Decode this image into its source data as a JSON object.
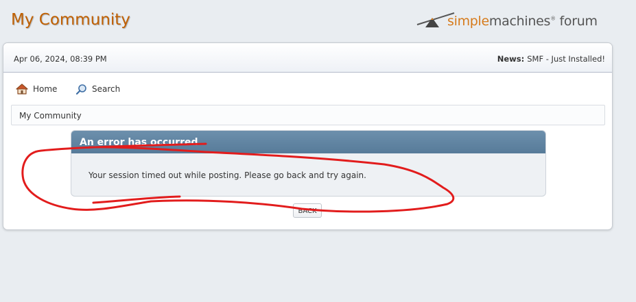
{
  "header": {
    "forum_name": "My Community",
    "logo": {
      "word_highlight": "simple",
      "word_rest": "machines",
      "registered": "®",
      "word_forum": "forum"
    }
  },
  "upper_bar": {
    "date": "Apr 06, 2024, 08:39 PM",
    "news_label": "News:",
    "news_text": "SMF - Just Installed!"
  },
  "menu": {
    "items": [
      {
        "label": "Home",
        "icon": "home-icon"
      },
      {
        "label": "Search",
        "icon": "search-icon"
      }
    ]
  },
  "breadcrumb": {
    "items": [
      "My Community"
    ]
  },
  "error": {
    "title": "An error has occurred",
    "message": "Your session timed out while posting. Please go back and try again."
  },
  "back_button": {
    "label": "BACK"
  },
  "colors": {
    "page_background": "#e9edf1",
    "forum_title": "#c06002",
    "logo_highlight": "#d67b1c",
    "error_header": "#5f83a1",
    "annotation_stroke": "#e21c1c"
  }
}
